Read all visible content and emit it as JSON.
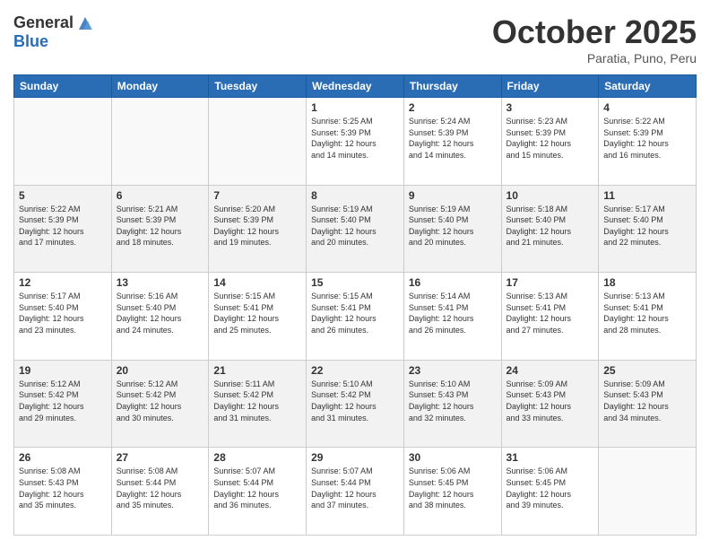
{
  "header": {
    "logo_general": "General",
    "logo_blue": "Blue",
    "month_title": "October 2025",
    "subtitle": "Paratia, Puno, Peru"
  },
  "days_of_week": [
    "Sunday",
    "Monday",
    "Tuesday",
    "Wednesday",
    "Thursday",
    "Friday",
    "Saturday"
  ],
  "weeks": [
    [
      {
        "day": "",
        "info": ""
      },
      {
        "day": "",
        "info": ""
      },
      {
        "day": "",
        "info": ""
      },
      {
        "day": "1",
        "info": "Sunrise: 5:25 AM\nSunset: 5:39 PM\nDaylight: 12 hours\nand 14 minutes."
      },
      {
        "day": "2",
        "info": "Sunrise: 5:24 AM\nSunset: 5:39 PM\nDaylight: 12 hours\nand 14 minutes."
      },
      {
        "day": "3",
        "info": "Sunrise: 5:23 AM\nSunset: 5:39 PM\nDaylight: 12 hours\nand 15 minutes."
      },
      {
        "day": "4",
        "info": "Sunrise: 5:22 AM\nSunset: 5:39 PM\nDaylight: 12 hours\nand 16 minutes."
      }
    ],
    [
      {
        "day": "5",
        "info": "Sunrise: 5:22 AM\nSunset: 5:39 PM\nDaylight: 12 hours\nand 17 minutes."
      },
      {
        "day": "6",
        "info": "Sunrise: 5:21 AM\nSunset: 5:39 PM\nDaylight: 12 hours\nand 18 minutes."
      },
      {
        "day": "7",
        "info": "Sunrise: 5:20 AM\nSunset: 5:39 PM\nDaylight: 12 hours\nand 19 minutes."
      },
      {
        "day": "8",
        "info": "Sunrise: 5:19 AM\nSunset: 5:40 PM\nDaylight: 12 hours\nand 20 minutes."
      },
      {
        "day": "9",
        "info": "Sunrise: 5:19 AM\nSunset: 5:40 PM\nDaylight: 12 hours\nand 20 minutes."
      },
      {
        "day": "10",
        "info": "Sunrise: 5:18 AM\nSunset: 5:40 PM\nDaylight: 12 hours\nand 21 minutes."
      },
      {
        "day": "11",
        "info": "Sunrise: 5:17 AM\nSunset: 5:40 PM\nDaylight: 12 hours\nand 22 minutes."
      }
    ],
    [
      {
        "day": "12",
        "info": "Sunrise: 5:17 AM\nSunset: 5:40 PM\nDaylight: 12 hours\nand 23 minutes."
      },
      {
        "day": "13",
        "info": "Sunrise: 5:16 AM\nSunset: 5:40 PM\nDaylight: 12 hours\nand 24 minutes."
      },
      {
        "day": "14",
        "info": "Sunrise: 5:15 AM\nSunset: 5:41 PM\nDaylight: 12 hours\nand 25 minutes."
      },
      {
        "day": "15",
        "info": "Sunrise: 5:15 AM\nSunset: 5:41 PM\nDaylight: 12 hours\nand 26 minutes."
      },
      {
        "day": "16",
        "info": "Sunrise: 5:14 AM\nSunset: 5:41 PM\nDaylight: 12 hours\nand 26 minutes."
      },
      {
        "day": "17",
        "info": "Sunrise: 5:13 AM\nSunset: 5:41 PM\nDaylight: 12 hours\nand 27 minutes."
      },
      {
        "day": "18",
        "info": "Sunrise: 5:13 AM\nSunset: 5:41 PM\nDaylight: 12 hours\nand 28 minutes."
      }
    ],
    [
      {
        "day": "19",
        "info": "Sunrise: 5:12 AM\nSunset: 5:42 PM\nDaylight: 12 hours\nand 29 minutes."
      },
      {
        "day": "20",
        "info": "Sunrise: 5:12 AM\nSunset: 5:42 PM\nDaylight: 12 hours\nand 30 minutes."
      },
      {
        "day": "21",
        "info": "Sunrise: 5:11 AM\nSunset: 5:42 PM\nDaylight: 12 hours\nand 31 minutes."
      },
      {
        "day": "22",
        "info": "Sunrise: 5:10 AM\nSunset: 5:42 PM\nDaylight: 12 hours\nand 31 minutes."
      },
      {
        "day": "23",
        "info": "Sunrise: 5:10 AM\nSunset: 5:43 PM\nDaylight: 12 hours\nand 32 minutes."
      },
      {
        "day": "24",
        "info": "Sunrise: 5:09 AM\nSunset: 5:43 PM\nDaylight: 12 hours\nand 33 minutes."
      },
      {
        "day": "25",
        "info": "Sunrise: 5:09 AM\nSunset: 5:43 PM\nDaylight: 12 hours\nand 34 minutes."
      }
    ],
    [
      {
        "day": "26",
        "info": "Sunrise: 5:08 AM\nSunset: 5:43 PM\nDaylight: 12 hours\nand 35 minutes."
      },
      {
        "day": "27",
        "info": "Sunrise: 5:08 AM\nSunset: 5:44 PM\nDaylight: 12 hours\nand 35 minutes."
      },
      {
        "day": "28",
        "info": "Sunrise: 5:07 AM\nSunset: 5:44 PM\nDaylight: 12 hours\nand 36 minutes."
      },
      {
        "day": "29",
        "info": "Sunrise: 5:07 AM\nSunset: 5:44 PM\nDaylight: 12 hours\nand 37 minutes."
      },
      {
        "day": "30",
        "info": "Sunrise: 5:06 AM\nSunset: 5:45 PM\nDaylight: 12 hours\nand 38 minutes."
      },
      {
        "day": "31",
        "info": "Sunrise: 5:06 AM\nSunset: 5:45 PM\nDaylight: 12 hours\nand 39 minutes."
      },
      {
        "day": "",
        "info": ""
      }
    ]
  ]
}
